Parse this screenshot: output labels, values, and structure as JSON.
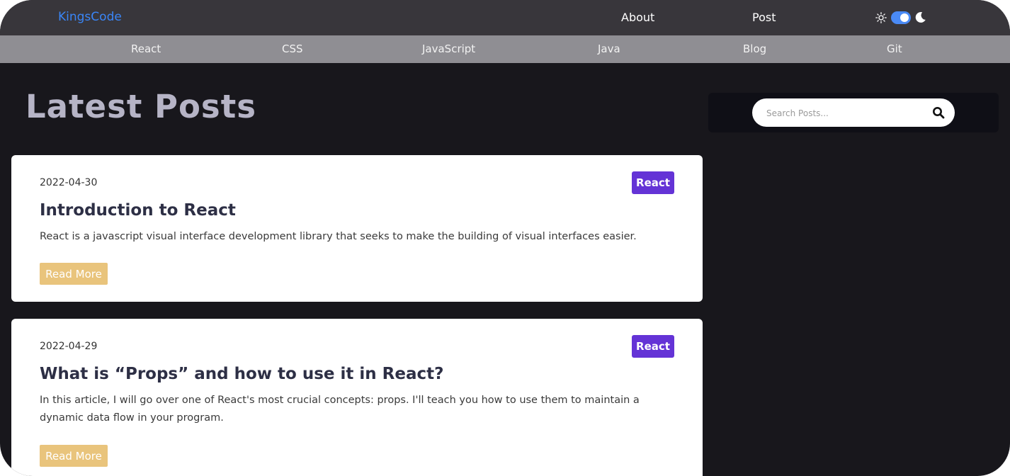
{
  "header": {
    "logo": "KingsCode",
    "nav": {
      "about": "About",
      "post": "Post"
    }
  },
  "categories": [
    "React",
    "CSS",
    "JavaScript",
    "Java",
    "Blog",
    "Git"
  ],
  "main": {
    "title": "Latest Posts"
  },
  "search": {
    "placeholder": "Search Posts..."
  },
  "posts": [
    {
      "date": "2022-04-30",
      "tag": "React",
      "title": "Introduction to React",
      "excerpt": "React is a javascript visual interface development library that seeks to make the building of visual interfaces easier.",
      "cta": "Read More"
    },
    {
      "date": "2022-04-29",
      "tag": "React",
      "title": "What is “Props” and how to use it in React?",
      "excerpt": "In this article, I will go over one of React's most crucial concepts: props. I'll teach you how to use them to maintain a dynamic data flow in your program.",
      "cta": "Read More"
    }
  ],
  "theme": {
    "dark_mode_enabled": true
  },
  "colors": {
    "accent": "#3a86f7",
    "tag": "#6433d6",
    "read_more": "#e9c47c",
    "background": "#18171c"
  },
  "icons": {
    "light": "sun-icon",
    "dark": "moon-icon",
    "search": "search-icon"
  }
}
